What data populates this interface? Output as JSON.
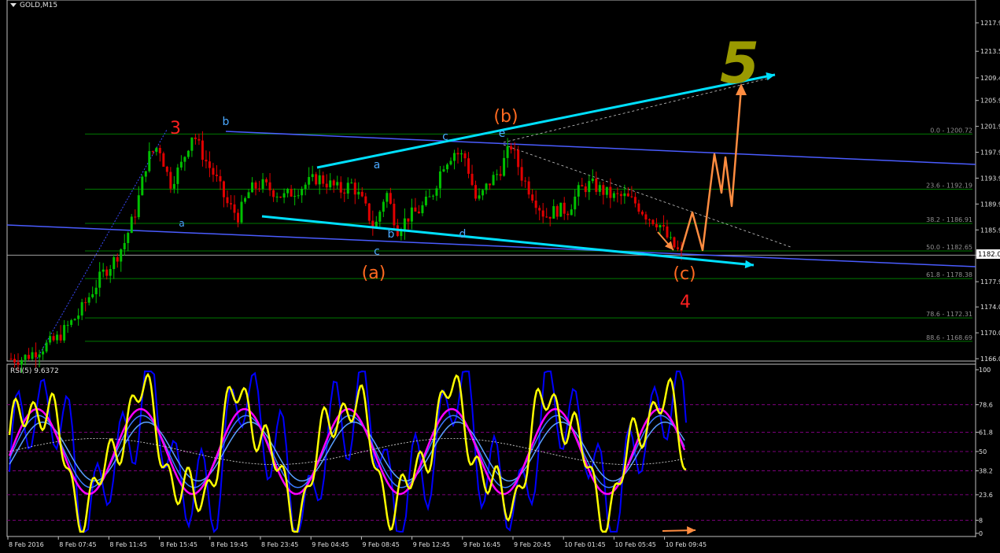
{
  "symbol": "GOLD,M15",
  "rsi_label": "RSI(5) 9.6372",
  "current_price": "1182.0",
  "colors": {
    "background": "#000000",
    "bull_candle": "#00c000",
    "bear_candle": "#e00000",
    "rsi_line": "#ffff00",
    "rsi_ma": "#ff00ff",
    "rsi_blue": "#0000ff",
    "channel": "#4a5cff",
    "triangle": "#00e0ff",
    "forecast": "#ff8c40",
    "fib": "#007a00"
  },
  "chart_data": [
    {
      "type": "candlestick",
      "symbol": "GOLD,M15",
      "ylim": [
        1165.5,
        1220.5
      ],
      "price_ticks": [
        "1217.9",
        "1213.5",
        "1209.4",
        "1205.9",
        "1201.9",
        "1197.9",
        "1193.9",
        "1189.9",
        "1185.9",
        "1182.0",
        "1177.9",
        "1174.0",
        "1170.0",
        "1166.0"
      ],
      "close_path": [
        1166,
        1166,
        1167,
        1168,
        1169,
        1171,
        1173,
        1176,
        1179,
        1181,
        1184,
        1189,
        1197,
        1199,
        1193,
        1196,
        1201,
        1197,
        1194,
        1190,
        1188,
        1192,
        1193,
        1192,
        1191,
        1192,
        1193,
        1194,
        1193,
        1192,
        1193,
        1190,
        1186,
        1192,
        1186,
        1188,
        1189,
        1191,
        1196,
        1198,
        1197,
        1190,
        1193,
        1195,
        1199,
        1194,
        1191,
        1188,
        1189,
        1189,
        1192,
        1193,
        1192,
        1191,
        1191,
        1190,
        1188,
        1187,
        1184,
        1182
      ],
      "fib_levels": [
        {
          "label": "0.0 - 1200.72",
          "price": 1200.72
        },
        {
          "label": "23.6 - 1192.19",
          "price": 1192.19
        },
        {
          "label": "38.2 - 1186.91",
          "price": 1186.91
        },
        {
          "label": "50.0 - 1182.65",
          "price": 1182.65
        },
        {
          "label": "61.8 - 1178.38",
          "price": 1178.38
        },
        {
          "label": "78.6 - 1172.31",
          "price": 1172.31
        },
        {
          "label": "88.6 - 1168.69",
          "price": 1168.69
        }
      ],
      "wave_labels": [
        {
          "text": "3",
          "color": "#ff2020"
        },
        {
          "text": "b",
          "color": "#4aa8ff"
        },
        {
          "text": "a",
          "color": "#4aa8ff"
        },
        {
          "text": "a",
          "color": "#4aa8ff"
        },
        {
          "text": "b",
          "color": "#4aa8ff"
        },
        {
          "text": "c",
          "color": "#4aa8ff"
        },
        {
          "text": "c",
          "color": "#4aa8ff"
        },
        {
          "text": "d",
          "color": "#4aa8ff"
        },
        {
          "text": "e",
          "color": "#4aa8ff"
        },
        {
          "text": "(a)",
          "color": "#ff6a20"
        },
        {
          "text": "(b)",
          "color": "#ff6a20"
        },
        {
          "text": "(c)",
          "color": "#ff6a20"
        },
        {
          "text": "4",
          "color": "#ff2020"
        },
        {
          "text": "5",
          "color": "#9a9a00"
        }
      ]
    },
    {
      "type": "line",
      "title": "RSI(5) 9.6372",
      "ylim": [
        0,
        100
      ],
      "ticks": [
        "100",
        "78.6",
        "61.8",
        "50",
        "38.2",
        "23.6",
        "8",
        "0"
      ],
      "levels": [
        100,
        78.6,
        61.8,
        50,
        38.2,
        23.6,
        8,
        0
      ],
      "last_value": 9.6372
    }
  ],
  "x_axis": [
    "8 Feb 2016",
    "8 Feb 07:45",
    "8 Feb 11:45",
    "8 Feb 15:45",
    "8 Feb 19:45",
    "8 Feb 23:45",
    "9 Feb 04:45",
    "9 Feb 08:45",
    "9 Feb 12:45",
    "9 Feb 16:45",
    "9 Feb 20:45",
    "10 Feb 01:45",
    "10 Feb 05:45",
    "10 Feb 09:45"
  ]
}
